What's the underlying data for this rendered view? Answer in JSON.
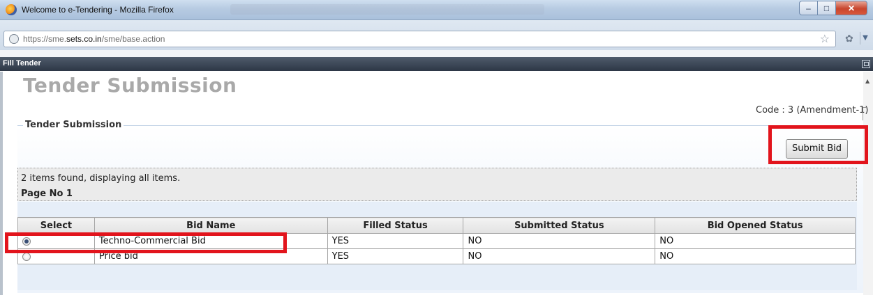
{
  "window": {
    "title": "Welcome to e-Tendering - Mozilla Firefox",
    "minimize_icon": "minimize-icon",
    "maximize_icon": "maximize-icon",
    "close_icon": "close-icon"
  },
  "browser": {
    "url_prefix": "https://sme.",
    "url_domain": "sets.co.in",
    "url_path": "/sme/base.action"
  },
  "panel": {
    "title": "Fill Tender"
  },
  "page": {
    "heading": "Tender Submission",
    "code": "Code : 3 (Amendment-1)",
    "fieldset_legend": "Tender Submission",
    "submit_label": "Submit Bid",
    "items_found": "2 items found, displaying all items.",
    "page_no": "Page No 1"
  },
  "table": {
    "headers": [
      "Select",
      "Bid Name",
      "Filled Status",
      "Submitted Status",
      "Bid Opened Status"
    ],
    "rows": [
      {
        "selected": true,
        "bid_name": "Techno-Commercial Bid",
        "filled": "YES",
        "submitted": "NO",
        "opened": "NO"
      },
      {
        "selected": false,
        "bid_name": "Price bid",
        "filled": "YES",
        "submitted": "NO",
        "opened": "NO"
      }
    ]
  },
  "colors": {
    "highlight": "#e2141c",
    "heading_gray": "#a9a9a9",
    "panel_bar": "#2d3746"
  }
}
